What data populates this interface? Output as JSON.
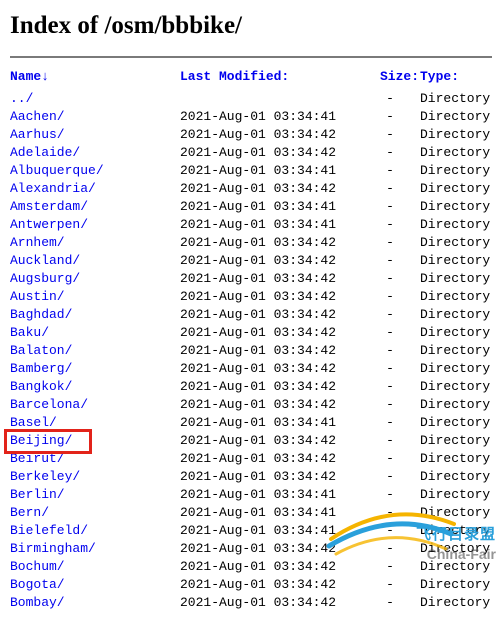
{
  "title": "Index of /osm/bbbike/",
  "headers": {
    "name": "Name↓",
    "modified": "Last Modified:",
    "size": "Size:",
    "type": "Type:"
  },
  "parent": "../",
  "size_placeholder": "-",
  "type_label": "Directory",
  "highlight_index": 18,
  "entries": [
    {
      "name": "Aachen/",
      "modified": "2021-Aug-01 03:34:41"
    },
    {
      "name": "Aarhus/",
      "modified": "2021-Aug-01 03:34:42"
    },
    {
      "name": "Adelaide/",
      "modified": "2021-Aug-01 03:34:42"
    },
    {
      "name": "Albuquerque/",
      "modified": "2021-Aug-01 03:34:41"
    },
    {
      "name": "Alexandria/",
      "modified": "2021-Aug-01 03:34:42"
    },
    {
      "name": "Amsterdam/",
      "modified": "2021-Aug-01 03:34:41"
    },
    {
      "name": "Antwerpen/",
      "modified": "2021-Aug-01 03:34:41"
    },
    {
      "name": "Arnhem/",
      "modified": "2021-Aug-01 03:34:42"
    },
    {
      "name": "Auckland/",
      "modified": "2021-Aug-01 03:34:42"
    },
    {
      "name": "Augsburg/",
      "modified": "2021-Aug-01 03:34:42"
    },
    {
      "name": "Austin/",
      "modified": "2021-Aug-01 03:34:42"
    },
    {
      "name": "Baghdad/",
      "modified": "2021-Aug-01 03:34:42"
    },
    {
      "name": "Baku/",
      "modified": "2021-Aug-01 03:34:42"
    },
    {
      "name": "Balaton/",
      "modified": "2021-Aug-01 03:34:42"
    },
    {
      "name": "Bamberg/",
      "modified": "2021-Aug-01 03:34:42"
    },
    {
      "name": "Bangkok/",
      "modified": "2021-Aug-01 03:34:42"
    },
    {
      "name": "Barcelona/",
      "modified": "2021-Aug-01 03:34:42"
    },
    {
      "name": "Basel/",
      "modified": "2021-Aug-01 03:34:41"
    },
    {
      "name": "Beijing/",
      "modified": "2021-Aug-01 03:34:42"
    },
    {
      "name": "Beirut/",
      "modified": "2021-Aug-01 03:34:42"
    },
    {
      "name": "Berkeley/",
      "modified": "2021-Aug-01 03:34:42"
    },
    {
      "name": "Berlin/",
      "modified": "2021-Aug-01 03:34:41"
    },
    {
      "name": "Bern/",
      "modified": "2021-Aug-01 03:34:41"
    },
    {
      "name": "Bielefeld/",
      "modified": "2021-Aug-01 03:34:41"
    },
    {
      "name": "Birmingham/",
      "modified": "2021-Aug-01 03:34:42"
    },
    {
      "name": "Bochum/",
      "modified": "2021-Aug-01 03:34:42"
    },
    {
      "name": "Bogota/",
      "modified": "2021-Aug-01 03:34:42"
    },
    {
      "name": "Bombay/",
      "modified": "2021-Aug-01 03:34:42"
    }
  ],
  "watermark": {
    "line1": "飞行目录盟",
    "line2": "China-Fair"
  }
}
